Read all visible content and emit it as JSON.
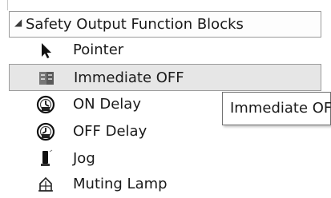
{
  "category": {
    "title": "Safety Output Function Blocks",
    "expand_icon": "collapse-triangle-icon"
  },
  "items": [
    {
      "label": "Pointer",
      "icon": "pointer-arrow-icon",
      "selected": false
    },
    {
      "label": "Immediate OFF",
      "icon": "immediate-off-block-icon",
      "selected": true
    },
    {
      "label": "ON Delay",
      "icon": "on-delay-timer-icon",
      "selected": false
    },
    {
      "label": "OFF Delay",
      "icon": "off-delay-timer-icon",
      "selected": false
    },
    {
      "label": "Jog",
      "icon": "jog-switch-icon",
      "selected": false
    },
    {
      "label": "Muting Lamp",
      "icon": "muting-lamp-icon",
      "selected": false
    }
  ],
  "tooltip": {
    "text": "Immediate OFF"
  },
  "colors": {
    "selection_bg": "#e6e6e6",
    "border": "#9a9a9a",
    "text": "#1a1a1a"
  }
}
